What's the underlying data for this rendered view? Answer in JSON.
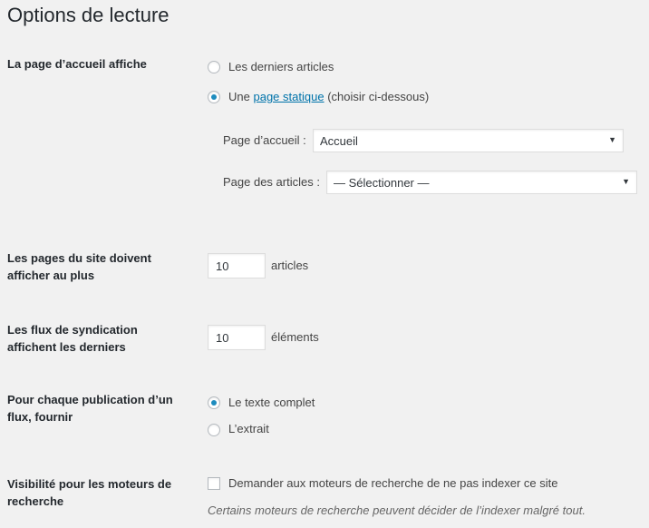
{
  "page": {
    "title": "Options de lecture"
  },
  "homepage": {
    "label": "La page d’accueil affiche",
    "option_latest": "Les derniers articles",
    "option_static_prefix": "Une",
    "option_static_link": "page statique",
    "option_static_suffix": "(choisir ci-dessous)",
    "selected": "static",
    "front_page_label": "Page d’accueil :",
    "front_page_value": "Accueil",
    "posts_page_label": "Page des articles :",
    "posts_page_value": "— Sélectionner —"
  },
  "posts_per_page": {
    "label_line1": "Les pages du site doivent",
    "label_line2": "afficher au plus",
    "value": "10",
    "unit": "articles"
  },
  "feeds": {
    "label_line1": "Les flux de syndication",
    "label_line2": "affichent les derniers",
    "value": "10",
    "unit": "éléments"
  },
  "feed_content": {
    "label_line1": "Pour chaque publication d’un",
    "label_line2": "flux, fournir",
    "option_full": "Le texte complet",
    "option_summary": "L’extrait",
    "selected": "full"
  },
  "visibility": {
    "label_line1": "Visibilité pour les moteurs de",
    "label_line2": "recherche",
    "checkbox_label": "Demander aux moteurs de recherche de ne pas indexer ce site",
    "checked": false,
    "description": "Certains moteurs de recherche peuvent décider de l’indexer malgré tout."
  },
  "icons": {
    "select_arrow": "chevron-down-icon"
  }
}
